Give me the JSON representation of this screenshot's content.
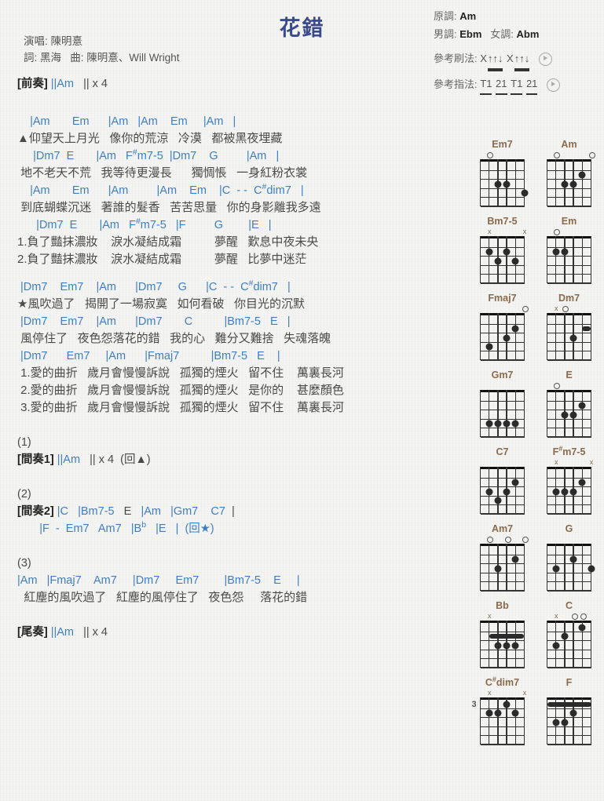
{
  "header": {
    "title": "花錯",
    "credits": [
      "演唱: 陳明憙",
      "詞: 黑海   曲: 陳明憙、Will Wright"
    ],
    "key_original_label": "原調:",
    "key_original": "Am",
    "key_male_label": "男調:",
    "key_male": "Ebm",
    "key_female_label": "女調:",
    "key_female": "Abm",
    "strum_label": "參考刷法:",
    "strum_pattern": "X ↑↑↓ X ↑↑↓",
    "finger_label": "參考指法:",
    "finger_pattern": "T1 21 T1 21"
  },
  "sheet": {
    "lines": [
      {
        "type": "plain",
        "text": "[前奏] ||Am   || x 4",
        "bold_prefix": "[前奏]"
      },
      {
        "type": "blank"
      },
      {
        "type": "blank"
      },
      {
        "type": "chord",
        "text": "    |Am       Em      |Am   |Am    Em     |Am   |"
      },
      {
        "type": "lyric",
        "text": "▲仰望天上月光   像你的荒涼   冷漠   都被黑夜埋藏"
      },
      {
        "type": "chord",
        "text": "     |Dm7  E       |Am   F#m7-5  |Dm7    G         |Am   |"
      },
      {
        "type": "lyric",
        "text": " 地不老天不荒   我等待更漫長      獨惆悵   一身紅粉衣裳"
      },
      {
        "type": "chord",
        "text": "    |Am       Em      |Am         |Am    Em    |C  - -  C#dim7   |"
      },
      {
        "type": "lyric",
        "text": " 到底蝴蝶沉迷   著誰的髮香   苦苦思量   你的身影離我多遠"
      },
      {
        "type": "chord",
        "text": "      |Dm7  E       |Am   F#m7-5   |F         G        |E   |"
      },
      {
        "type": "lyric",
        "text": "1.負了豔抹濃妝    淚水凝結成霜          夢醒   歎息中夜未央"
      },
      {
        "type": "lyric",
        "text": "2.負了豔抹濃妝    淚水凝結成霜          夢醒   比夢中迷茫"
      },
      {
        "type": "blank"
      },
      {
        "type": "chord",
        "text": " |Dm7    Em7    |Am      |Dm7     G      |C  - -  C#dim7   |"
      },
      {
        "type": "lyric",
        "text": "★風吹過了   揭開了一場寂寞   如何看破   你目光的沉默"
      },
      {
        "type": "chord",
        "text": " |Dm7    Em7    |Am      |Dm7       C          |Bm7-5   E   |"
      },
      {
        "type": "lyric",
        "text": " 風停住了   夜色怨落花的錯   我的心   難分又難捨   失魂落魄"
      },
      {
        "type": "chord",
        "text": " |Dm7      Em7     |Am      |Fmaj7          |Bm7-5   E    |"
      },
      {
        "type": "lyric",
        "text": " 1.愛的曲折   歲月會慢慢訴說   孤獨的煙火   留不住    萬裏長河"
      },
      {
        "type": "lyric",
        "text": " 2.愛的曲折   歲月會慢慢訴說   孤獨的煙火   是你的    甚麼顏色"
      },
      {
        "type": "lyric",
        "text": " 3.愛的曲折   歲月會慢慢訴說   孤獨的煙火   留不住    萬裏長河"
      },
      {
        "type": "blank2"
      },
      {
        "type": "plain",
        "text": "(1)"
      },
      {
        "type": "plain",
        "text": "[間奏1] ||Am   || x 4  (回▲)",
        "bold_prefix": "[間奏1]"
      },
      {
        "type": "blank2"
      },
      {
        "type": "plain",
        "text": "(2)"
      },
      {
        "type": "plain",
        "text": "[間奏2] |C   |Bm7-5   E   |Am   |Gm7    C7  |",
        "bold_prefix": "[間奏2]"
      },
      {
        "type": "chord",
        "text": "       |F  -  Em7   Am7   |Bb   |E   |  (回★)"
      },
      {
        "type": "blank2"
      },
      {
        "type": "plain",
        "text": "(3)"
      },
      {
        "type": "chord",
        "text": "|Am   |Fmaj7    Am7     |Dm7     Em7        |Bm7-5    E     |"
      },
      {
        "type": "lyric",
        "text": "  紅塵的風吹過了   紅塵的風停住了   夜色怨     落花的錯"
      },
      {
        "type": "blank2"
      },
      {
        "type": "plain",
        "text": "[尾奏] ||Am   || x 4",
        "bold_prefix": "[尾奏]"
      }
    ]
  },
  "chord_diagrams": [
    {
      "name": "Em7",
      "markers": [
        {
          "str": 1,
          "type": "o"
        }
      ],
      "dots": [
        {
          "str": 2,
          "fret": 2
        },
        {
          "str": 3,
          "fret": 2
        },
        {
          "str": 5,
          "fret": 3
        }
      ]
    },
    {
      "name": "Am",
      "markers": [
        {
          "str": 1,
          "type": "o"
        },
        {
          "str": 5,
          "type": "o"
        }
      ],
      "dots": [
        {
          "str": 4,
          "fret": 1
        },
        {
          "str": 2,
          "fret": 2
        },
        {
          "str": 3,
          "fret": 2
        }
      ]
    },
    {
      "name": "Bm7-5",
      "markers": [
        {
          "str": 1,
          "type": "x"
        },
        {
          "str": 5,
          "type": "x"
        }
      ],
      "dots": [
        {
          "str": 1,
          "fret": 1
        },
        {
          "str": 3,
          "fret": 1
        },
        {
          "str": 2,
          "fret": 2
        },
        {
          "str": 4,
          "fret": 2
        }
      ]
    },
    {
      "name": "Em",
      "markers": [
        {
          "str": 1,
          "type": "o"
        }
      ],
      "dots": [
        {
          "str": 1,
          "fret": 1
        },
        {
          "str": 2,
          "fret": 1
        }
      ]
    },
    {
      "name": "Fmaj7",
      "markers": [
        {
          "str": 5,
          "type": "o"
        }
      ],
      "dots": [
        {
          "str": 4,
          "fret": 1
        },
        {
          "str": 3,
          "fret": 2
        },
        {
          "str": 1,
          "fret": 3
        }
      ]
    },
    {
      "name": "Dm7",
      "markers": [
        {
          "str": 1,
          "type": "x"
        },
        {
          "str": 2,
          "type": "o"
        }
      ],
      "dots": [
        {
          "str": 3,
          "fret": 2
        }
      ],
      "barres": [
        {
          "from": 4,
          "to": 5,
          "fret": 1
        }
      ]
    },
    {
      "name": "Gm7",
      "markers": [],
      "dots": [
        {
          "str": 1,
          "fret": 3
        },
        {
          "str": 2,
          "fret": 3
        },
        {
          "str": 3,
          "fret": 3
        },
        {
          "str": 4,
          "fret": 3
        }
      ]
    },
    {
      "name": "E",
      "markers": [
        {
          "str": 1,
          "type": "o"
        }
      ],
      "dots": [
        {
          "str": 4,
          "fret": 1
        },
        {
          "str": 2,
          "fret": 2
        },
        {
          "str": 3,
          "fret": 2
        }
      ]
    },
    {
      "name": "C7",
      "markers": [],
      "dots": [
        {
          "str": 1,
          "fret": 2
        },
        {
          "str": 3,
          "fret": 2
        },
        {
          "str": 2,
          "fret": 3
        },
        {
          "str": 4,
          "fret": 1
        }
      ]
    },
    {
      "name": "F#m7-5",
      "markers": [
        {
          "str": 1,
          "type": "x"
        },
        {
          "str": 5,
          "type": "x"
        }
      ],
      "dots": [
        {
          "str": 1,
          "fret": 2
        },
        {
          "str": 2,
          "fret": 2
        },
        {
          "str": 3,
          "fret": 2
        },
        {
          "str": 4,
          "fret": 1
        }
      ]
    },
    {
      "name": "Am7",
      "markers": [
        {
          "str": 1,
          "type": "o"
        },
        {
          "str": 3,
          "type": "o"
        },
        {
          "str": 5,
          "type": "o"
        }
      ],
      "dots": [
        {
          "str": 2,
          "fret": 2
        },
        {
          "str": 4,
          "fret": 1
        }
      ]
    },
    {
      "name": "G",
      "markers": [],
      "dots": [
        {
          "str": 1,
          "fret": 2
        },
        {
          "str": 3,
          "fret": 1
        },
        {
          "str": 5,
          "fret": 2
        }
      ]
    },
    {
      "name": "Bb",
      "markers": [
        {
          "str": 1,
          "type": "x"
        }
      ],
      "dots": [
        {
          "str": 2,
          "fret": 2
        },
        {
          "str": 3,
          "fret": 2
        },
        {
          "str": 4,
          "fret": 2
        }
      ],
      "barres": [
        {
          "from": 1,
          "to": 5,
          "fret": 1
        }
      ]
    },
    {
      "name": "C",
      "markers": [
        {
          "str": 1,
          "type": "x"
        },
        {
          "str": 3,
          "type": "o"
        },
        {
          "str": 4,
          "type": "o"
        }
      ],
      "dots": [
        {
          "str": 1,
          "fret": 2
        },
        {
          "str": 2,
          "fret": 1
        },
        {
          "str": 4,
          "fret": 0
        }
      ]
    },
    {
      "name": "C#dim7",
      "markers": [
        {
          "str": 1,
          "type": "x"
        },
        {
          "str": 5,
          "type": "x"
        }
      ],
      "dots": [
        {
          "str": 3,
          "fret": 0
        },
        {
          "str": 1,
          "fret": 1
        },
        {
          "str": 2,
          "fret": 1
        },
        {
          "str": 4,
          "fret": 1
        }
      ],
      "fret_label": "3"
    },
    {
      "name": "F",
      "markers": [],
      "dots": [
        {
          "str": 3,
          "fret": 1
        },
        {
          "str": 1,
          "fret": 2
        },
        {
          "str": 2,
          "fret": 2
        }
      ],
      "barres": [
        {
          "from": 0,
          "to": 5,
          "fret": 0
        }
      ]
    }
  ]
}
